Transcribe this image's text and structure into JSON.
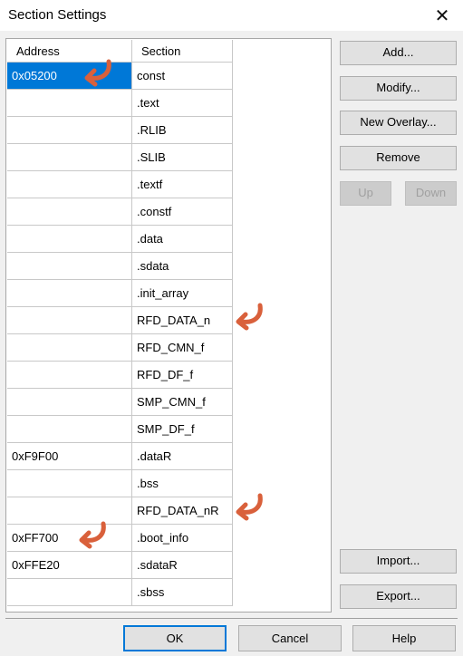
{
  "window": {
    "title": "Section Settings"
  },
  "table": {
    "headers": {
      "address": "Address",
      "section": "Section"
    },
    "rows": [
      {
        "address": "0x05200",
        "section": "const"
      },
      {
        "address": "",
        "section": ".text"
      },
      {
        "address": "",
        "section": ".RLIB"
      },
      {
        "address": "",
        "section": ".SLIB"
      },
      {
        "address": "",
        "section": ".textf"
      },
      {
        "address": "",
        "section": ".constf"
      },
      {
        "address": "",
        "section": ".data"
      },
      {
        "address": "",
        "section": ".sdata"
      },
      {
        "address": "",
        "section": ".init_array"
      },
      {
        "address": "",
        "section": "RFD_DATA_n"
      },
      {
        "address": "",
        "section": "RFD_CMN_f"
      },
      {
        "address": "",
        "section": "RFD_DF_f"
      },
      {
        "address": "",
        "section": "SMP_CMN_f"
      },
      {
        "address": "",
        "section": "SMP_DF_f"
      },
      {
        "address": "0xF9F00",
        "section": ".dataR"
      },
      {
        "address": "",
        "section": ".bss"
      },
      {
        "address": "",
        "section": "RFD_DATA_nR"
      },
      {
        "address": "0xFF700",
        "section": ".boot_info"
      },
      {
        "address": "0xFFE20",
        "section": ".sdataR"
      },
      {
        "address": "",
        "section": ".sbss"
      }
    ]
  },
  "side_buttons": {
    "add": "Add...",
    "modify": "Modify...",
    "new_overlay": "New Overlay...",
    "remove": "Remove",
    "up": "Up",
    "down": "Down",
    "import": "Import...",
    "export": "Export..."
  },
  "footer_buttons": {
    "ok": "OK",
    "cancel": "Cancel",
    "help": "Help"
  },
  "icons": {
    "close": "close-icon",
    "annotation_arrow": "curved-arrow-icon"
  },
  "colors": {
    "selection": "#0078d7",
    "annotation_arrow": "#d9603b"
  }
}
